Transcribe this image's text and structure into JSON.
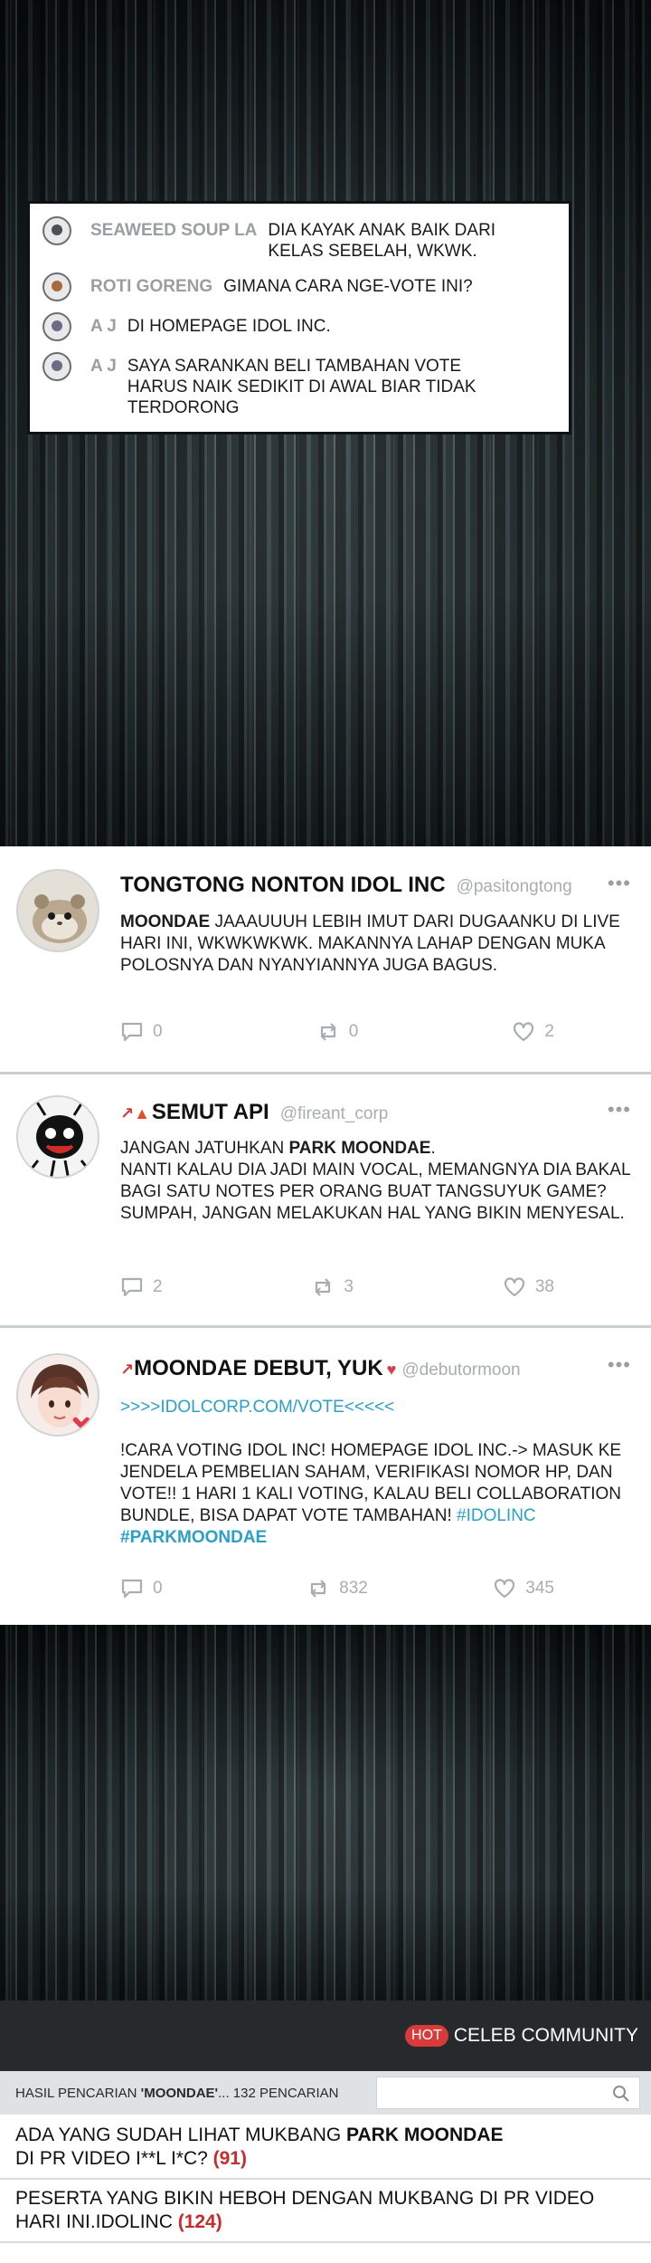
{
  "comments": [
    {
      "name": "SEAWEED SOUP LA",
      "text_line1": "DIA KAYAK ANAK BAIK DARI",
      "text_line2": "KELAS SEBELAH, WKWK.",
      "avatar_color": "#4a5256"
    },
    {
      "name": "ROTI GORENG",
      "text": "GIMANA CARA NGE-VOTE INI?",
      "avatar_color": "#a86a3a"
    },
    {
      "name": "A J",
      "text": "DI HOMEPAGE IDOL INC.",
      "avatar_color": "#6e6a86"
    },
    {
      "name": "A J",
      "text_line1": "SAYA SARANKAN BELI TAMBAHAN VOTE",
      "text_line2": "HARUS NAIK SEDIKIT DI AWAL BIAR TIDAK",
      "text_line3": "TERDORONG",
      "avatar_color": "#6e6a86"
    }
  ],
  "tweets": [
    {
      "name": "TONGTONG NONTON IDOL INC",
      "handle": "@pasitongtong",
      "more": "•••",
      "body_bold": "MOONDAE",
      "body_rest": " JAAAUUUH LEBIH IMUT DARI DUGAANKU DI LIVE HARI INI, WKWKWKWK. MAKANNYA LAHAP DENGAN MUKA POLOSNYA DAN NYANYIANNYA JUGA BAGUS.",
      "replies": "0",
      "retweets": "0",
      "likes": "2"
    },
    {
      "name": "SEMUT API",
      "handle": "@fireant_corp",
      "more": "•••",
      "line1_pre": "JANGAN JATUHKAN ",
      "line1_bold": "PARK MOONDAE",
      "line1_post": ".",
      "body_rest": "NANTI KALAU DIA JADI MAIN VOCAL, MEMANGNYA DIA BAKAL BAGI SATU NOTES PER ORANG BUAT TANGSUYUK GAME? SUMPAH, JANGAN MELAKUKAN HAL YANG BIKIN MENYESAL.",
      "replies": "2",
      "retweets": "3",
      "likes": "38"
    },
    {
      "name": "MOONDAE DEBUT, YUK",
      "handle": "@debutormoon",
      "more": "•••",
      "link": ">>>>IDOLCORP.COM/VOTE<<<<<",
      "body_rest": "!CARA VOTING IDOL INC! HOMEPAGE IDOL INC.-> MASUK KE JENDELA PEMBELIAN SAHAM, VERIFIKASI NOMOR HP, DAN VOTE!! 1 HARI 1 KALI VOTING, KALAU BELI COLLABORATION BUNDLE, BISA DAPAT VOTE TAMBAHAN! ",
      "tag1": "#IDOLINC",
      "tag2": "#PARKMOONDAE",
      "replies": "0",
      "retweets": "832",
      "likes": "345"
    }
  ],
  "community": {
    "badge": "HOT",
    "title": "CELEB COMMUNITY",
    "search_summary_pre": "HASIL PENCARIAN ",
    "search_summary_bold": "'MOONDAE'",
    "search_summary_post": "... 132 PENCARIAN",
    "search_value": "",
    "results": [
      {
        "line1_pre": "ADA YANG SUDAH LIHAT MUKBANG ",
        "line1_bold": "PARK MOONDAE",
        "line2": "DI PR VIDEO I**L I*C? ",
        "count": "(91)"
      },
      {
        "line1": "PESERTA YANG BIKIN HEBOH DENGAN MUKBANG DI PR VIDEO",
        "line2": "HARI INI.IDOLINC ",
        "count": "(124)"
      }
    ]
  },
  "colors": {
    "accent_link": "#2a9fc8",
    "count_red": "#c92b2b",
    "hot_badge": "#d93b3b"
  }
}
